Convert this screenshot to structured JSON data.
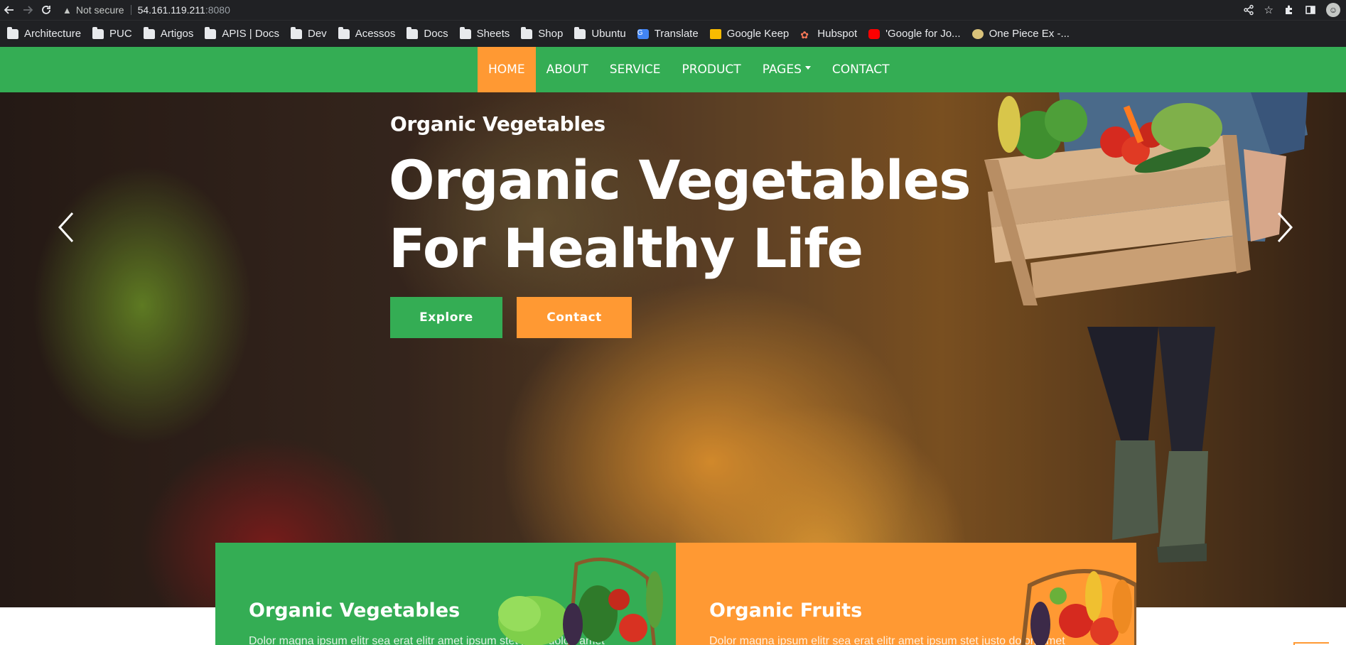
{
  "browser": {
    "security_label": "Not secure",
    "url_host": "54.161.119.211",
    "url_port": ":8080",
    "avatar_letter": "☺"
  },
  "bookmarks": [
    {
      "label": "Architecture",
      "icon": "folder-icon"
    },
    {
      "label": "PUC",
      "icon": "folder-icon"
    },
    {
      "label": "Artigos",
      "icon": "folder-icon"
    },
    {
      "label": "APIS | Docs",
      "icon": "folder-icon"
    },
    {
      "label": "Dev",
      "icon": "folder-icon"
    },
    {
      "label": "Acessos",
      "icon": "folder-icon"
    },
    {
      "label": "Docs",
      "icon": "folder-icon"
    },
    {
      "label": "Sheets",
      "icon": "folder-icon"
    },
    {
      "label": "Shop",
      "icon": "folder-icon"
    },
    {
      "label": "Ubuntu",
      "icon": "folder-icon"
    },
    {
      "label": "Translate",
      "icon": "google-translate-icon"
    },
    {
      "label": "Google Keep",
      "icon": "google-keep-icon"
    },
    {
      "label": "Hubspot",
      "icon": "hubspot-icon"
    },
    {
      "label": "'Google for Jo...",
      "icon": "youtube-icon"
    },
    {
      "label": "One Piece Ex -...",
      "icon": "one-piece-icon"
    }
  ],
  "nav": {
    "items": [
      "HOME",
      "ABOUT",
      "SERVICE",
      "PRODUCT",
      "PAGES",
      "CONTACT"
    ],
    "active": "HOME"
  },
  "hero": {
    "subtitle": "Organic Vegetables",
    "title_line1": "Organic Vegetables",
    "title_line2": "For Healthy Life",
    "explore_label": "Explore",
    "contact_label": "Contact"
  },
  "features": [
    {
      "title": "Organic Vegetables",
      "text": "Dolor magna ipsum elitr sea erat elitr amet ipsum stet justo dolor, amet",
      "color": "#34ad54"
    },
    {
      "title": "Organic Fruits",
      "text": "Dolor magna ipsum elitr sea erat elitr amet ipsum stet justo dolor, amet",
      "color": "#ff9933"
    }
  ],
  "colors": {
    "green": "#34ad54",
    "orange": "#ff9933",
    "chrome_bg": "#202124"
  }
}
